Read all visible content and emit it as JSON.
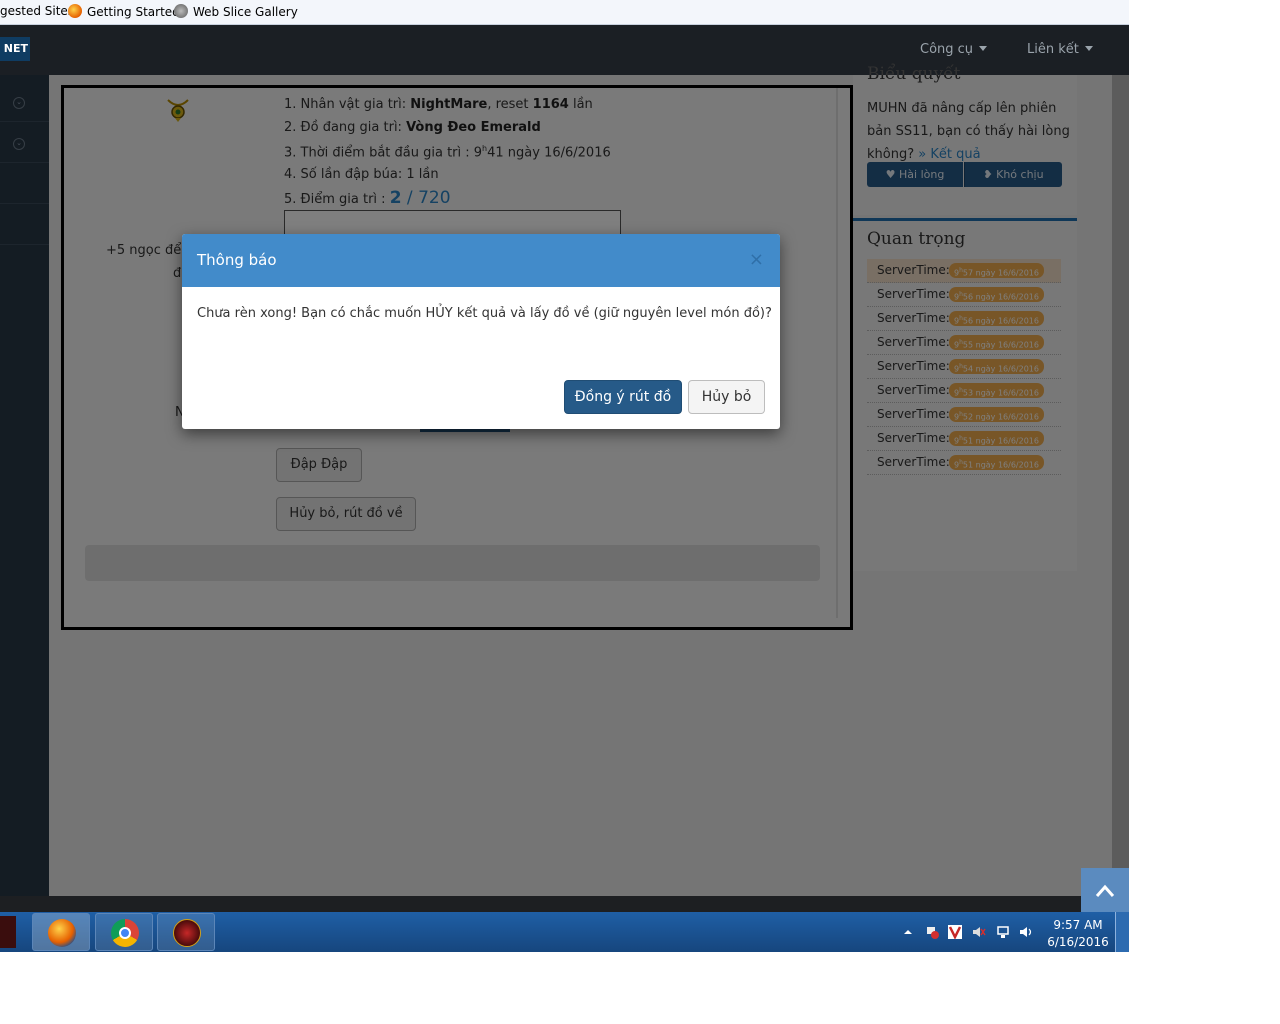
{
  "bookmarks": [
    {
      "label": "gested Sites"
    },
    {
      "label": "Getting Started"
    },
    {
      "label": "Web Slice Gallery"
    }
  ],
  "navbar": {
    "logo": "NET",
    "menu": [
      {
        "label": "Công cụ"
      },
      {
        "label": "Liên kết"
      }
    ]
  },
  "forge": {
    "line1": {
      "prefix": "1. Nhân vật gia trì: ",
      "name": "NightMare",
      "mid": ", reset ",
      "reset": "1164",
      "suffix": " lần"
    },
    "line2": {
      "prefix": "2. Đồ đang gia trì: ",
      "item": "Vòng Đeo Emerald"
    },
    "line3": {
      "prefix": "3. Thời điểm bắt đầu gia trì : 9",
      "sup": "h",
      "suffix": "41 ngày 16/6/2016"
    },
    "line4": "4. Số lần đập búa: 1 lần",
    "line5": {
      "prefix": "5. Điểm gia trì : ",
      "current": "2",
      "sep": " / ",
      "max": "720"
    },
    "left_text_1": "+5 ngọc để t",
    "left_text_2": "đ",
    "left_text_3": "N",
    "hammer_button": "Đập Đập",
    "cancel_withdraw_button": "Hủy bỏ, rút đồ về"
  },
  "vote": {
    "title": "Biểu quyết",
    "question": [
      "MUHN đã nâng cấp lên phiên",
      "bản SS11, bạn có thấy hài lòng"
    ],
    "question_last": "không? ",
    "result_link": "» Kết quả",
    "satisfied": "Hài lòng",
    "unsatisfied": "Khó chịu"
  },
  "important": {
    "title": "Quan trọng",
    "rows": [
      {
        "label": "ServerTime:",
        "hour": "9",
        "sup": "h",
        "rest": "57 ngày 16/6/2016"
      },
      {
        "label": "ServerTime:",
        "hour": "9",
        "sup": "h",
        "rest": "56 ngày 16/6/2016"
      },
      {
        "label": "ServerTime:",
        "hour": "9",
        "sup": "h",
        "rest": "56 ngày 16/6/2016"
      },
      {
        "label": "ServerTime:",
        "hour": "9",
        "sup": "h",
        "rest": "55 ngày 16/6/2016"
      },
      {
        "label": "ServerTime:",
        "hour": "9",
        "sup": "h",
        "rest": "54 ngày 16/6/2016"
      },
      {
        "label": "ServerTime:",
        "hour": "9",
        "sup": "h",
        "rest": "53 ngày 16/6/2016"
      },
      {
        "label": "ServerTime:",
        "hour": "9",
        "sup": "h",
        "rest": "52 ngày 16/6/2016"
      },
      {
        "label": "ServerTime:",
        "hour": "9",
        "sup": "h",
        "rest": "51 ngày 16/6/2016"
      },
      {
        "label": "ServerTime:",
        "hour": "9",
        "sup": "h",
        "rest": "51 ngày 16/6/2016"
      }
    ]
  },
  "modal": {
    "title": "Thông báo",
    "close": "×",
    "body": "Chưa rèn xong! Bạn có chắc muốn HỦY kết quả và lấy đồ về (giữ nguyên level món đồ)?",
    "confirm": "Đồng ý rút đồ",
    "cancel": "Hủy bỏ"
  },
  "taskbar": {
    "time": "9:57 AM",
    "date": "6/16/2016"
  },
  "colors": {
    "modal_header": "#428bca",
    "primary_button": "#265a88",
    "badge": "#f0ad4e",
    "navbar": "#1b1f24",
    "sidebar": "#293846"
  }
}
